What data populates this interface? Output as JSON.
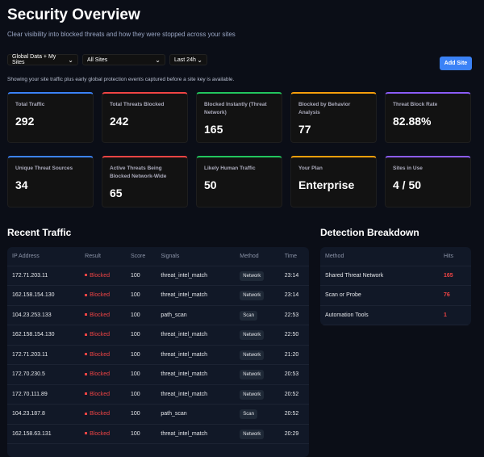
{
  "header": {
    "title": "Security Overview",
    "subtitle": "Clear visibility into blocked threats and how they were stopped across your sites"
  },
  "filters": {
    "data_source": "Global Data + My Sites",
    "site": "All Sites",
    "range": "Last 24h"
  },
  "add_site": "Add Site",
  "note": "Showing your site traffic plus early global protection events captured before a site key is available.",
  "stats": [
    {
      "label": "Total Traffic",
      "value": "292",
      "color": "#3b82f6"
    },
    {
      "label": "Total Threats Blocked",
      "value": "242",
      "color": "#ef4444"
    },
    {
      "label": "Blocked Instantly (Threat Network)",
      "value": "165",
      "color": "#22c55e"
    },
    {
      "label": "Blocked by Behavior Analysis",
      "value": "77",
      "color": "#f59e0b"
    },
    {
      "label": "Threat Block Rate",
      "value": "82.88%",
      "color": "#8b5cf6"
    },
    {
      "label": "Unique Threat Sources",
      "value": "34",
      "color": "#3b82f6"
    },
    {
      "label": "Active Threats Being Blocked Network-Wide",
      "value": "65",
      "color": "#ef4444"
    },
    {
      "label": "Likely Human Traffic",
      "value": "50",
      "color": "#22c55e"
    },
    {
      "label": "Your Plan",
      "value": "Enterprise",
      "color": "#f59e0b"
    },
    {
      "label": "Sites in Use",
      "value": "4 / 50",
      "color": "#8b5cf6"
    }
  ],
  "traffic": {
    "title": "Recent Traffic",
    "columns": [
      "IP Address",
      "Result",
      "Score",
      "Signals",
      "Method",
      "Time"
    ],
    "rows": [
      [
        "172.71.203.11",
        "Blocked",
        "100",
        "threat_intel_match",
        "Network",
        "23:14"
      ],
      [
        "162.158.154.130",
        "Blocked",
        "100",
        "threat_intel_match",
        "Network",
        "23:14"
      ],
      [
        "104.23.253.133",
        "Blocked",
        "100",
        "path_scan",
        "Scan",
        "22:53"
      ],
      [
        "162.158.154.130",
        "Blocked",
        "100",
        "threat_intel_match",
        "Network",
        "22:50"
      ],
      [
        "172.71.203.11",
        "Blocked",
        "100",
        "threat_intel_match",
        "Network",
        "21:20"
      ],
      [
        "172.70.230.5",
        "Blocked",
        "100",
        "threat_intel_match",
        "Network",
        "20:53"
      ],
      [
        "172.70.111.89",
        "Blocked",
        "100",
        "threat_intel_match",
        "Network",
        "20:52"
      ],
      [
        "104.23.187.8",
        "Blocked",
        "100",
        "path_scan",
        "Scan",
        "20:52"
      ],
      [
        "162.158.63.131",
        "Blocked",
        "100",
        "threat_intel_match",
        "Network",
        "20:29"
      ]
    ]
  },
  "breakdown": {
    "title": "Detection Breakdown",
    "columns": [
      "Method",
      "Hits"
    ],
    "rows": [
      [
        "Shared Threat Network",
        "165"
      ],
      [
        "Scan or Probe",
        "76"
      ],
      [
        "Automation Tools",
        "1"
      ]
    ]
  }
}
